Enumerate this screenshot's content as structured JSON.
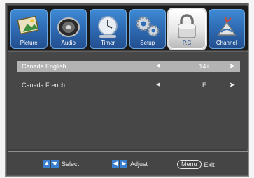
{
  "tabs": [
    {
      "label": "Picture",
      "icon": "picture-icon"
    },
    {
      "label": "Audio",
      "icon": "audio-icon"
    },
    {
      "label": "Timer",
      "icon": "timer-icon"
    },
    {
      "label": "Setup",
      "icon": "setup-icon"
    },
    {
      "label": "P.G",
      "icon": "lock-icon",
      "active": true
    },
    {
      "label": "Channel",
      "icon": "channel-icon"
    }
  ],
  "settings": [
    {
      "name": "Canada English",
      "value": "14+",
      "selected": true
    },
    {
      "name": "Canada French",
      "value": "E",
      "selected": false
    }
  ],
  "footer": {
    "select_label": "Select",
    "adjust_label": "Adjust",
    "menu_key": "Menu",
    "exit_label": "Exit"
  },
  "colors": {
    "tab_blue": "#2f6db6",
    "selection_gray": "#b3b3b3",
    "panel": "#474747"
  }
}
